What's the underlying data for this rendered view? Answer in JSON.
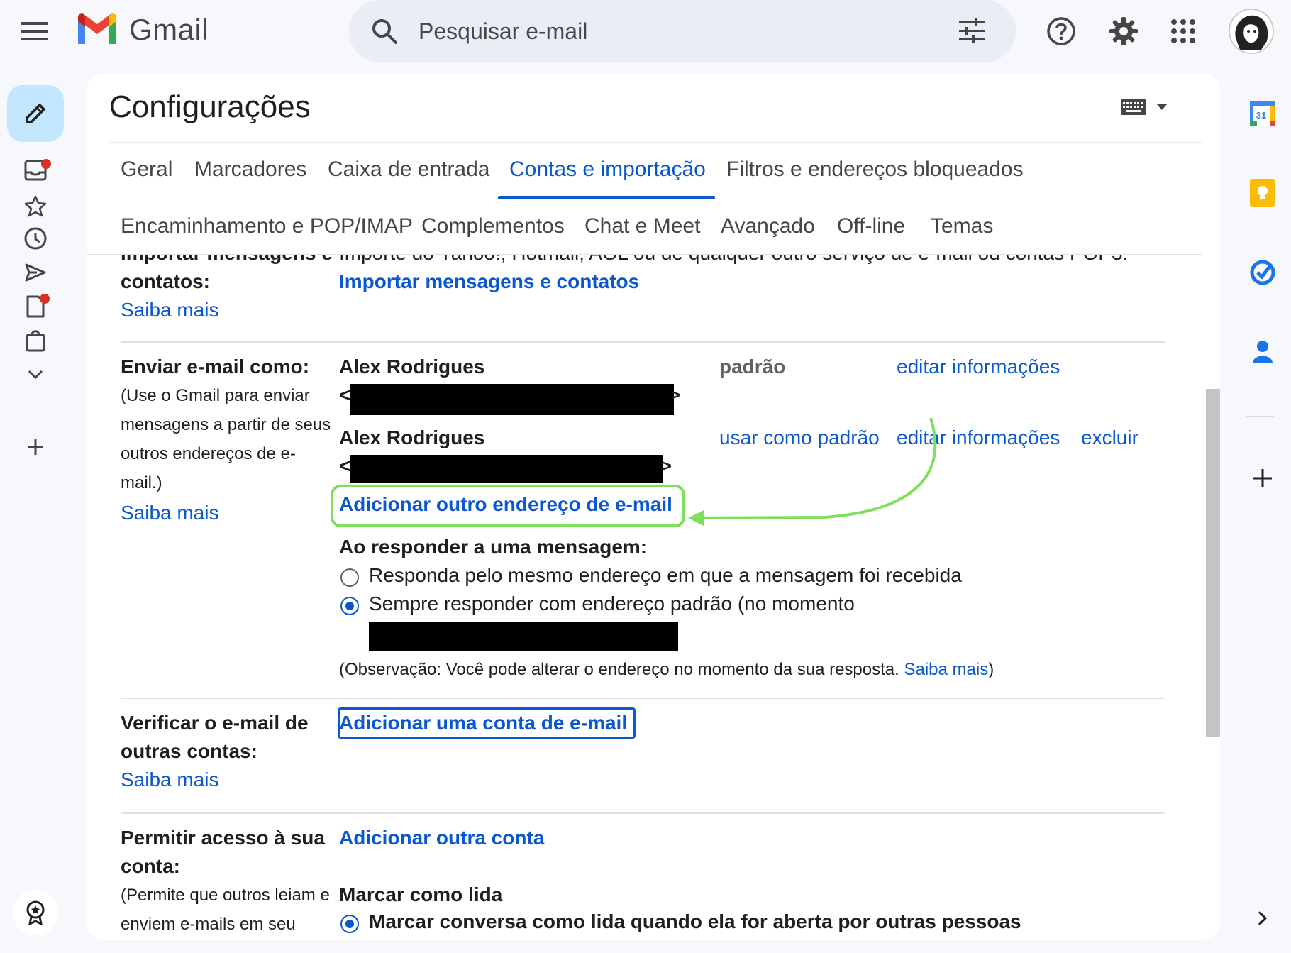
{
  "header": {
    "app_name": "Gmail",
    "search_placeholder": "Pesquisar e-mail"
  },
  "settings": {
    "title": "Configurações",
    "tabs_row1": [
      "Geral",
      "Marcadores",
      "Caixa de entrada",
      "Contas e importação",
      "Filtros e endereços bloqueados"
    ],
    "tabs_row2": [
      "Encaminhamento e POP/IMAP",
      "Complementos",
      "Chat e Meet",
      "Avançado",
      "Off-line",
      "Temas"
    ],
    "active_tab": "Contas e importação"
  },
  "import_section": {
    "label_partial": "Importar mensagens e",
    "label_rest": "contatos:",
    "desc_partial": "Importe do Yahoo!, Hotmail, AOL ou de qualquer outro serviço de e-mail ou contas POP3.",
    "action": "Importar mensagens e contatos",
    "learn_more": "Saiba mais"
  },
  "send_as": {
    "label": "Enviar e-mail como:",
    "desc_lines": [
      "(Use o Gmail para enviar",
      "mensagens a partir de seus",
      "outros endereços de e-",
      "mail.)"
    ],
    "learn_more": "Saiba mais",
    "accounts": [
      {
        "name": "Alex Rodrigues",
        "status": "padrão",
        "edit": "editar informações"
      },
      {
        "name": "Alex Rodrigues",
        "make_default": "usar como padrão",
        "edit": "editar informações",
        "delete": "excluir"
      }
    ],
    "add_address": "Adicionar outro endereço de e-mail",
    "reply_heading": "Ao responder a uma mensagem:",
    "reply_options": [
      {
        "label": "Responda pelo mesmo endereço em que a mensagem foi recebida",
        "selected": false
      },
      {
        "label": "Sempre responder com endereço padrão (no momento",
        "selected": true
      }
    ],
    "note_prefix": "(Observação: Você pode alterar o endereço no momento da sua resposta. ",
    "note_link": "Saiba mais",
    "note_suffix": ")"
  },
  "check_mail": {
    "label_lines": [
      "Verificar o e-mail de",
      "outras contas:"
    ],
    "learn_more": "Saiba mais",
    "action": "Adicionar uma conta de e-mail"
  },
  "grant_access": {
    "label_lines": [
      "Permitir acesso à sua",
      "conta:"
    ],
    "desc_lines": [
      "(Permite que outros leiam e",
      "enviem e-mails em seu"
    ],
    "action": "Adicionar outra conta",
    "mark_read_heading": "Marcar como lida",
    "mark_read_option": "Marcar conversa como lida quando ela for aberta por outras pessoas"
  },
  "right_rail": {
    "calendar_day": "31"
  },
  "colors": {
    "accent": "#0b57d0",
    "highlight": "#7de05a",
    "compose_bg": "#c2e7ff",
    "search_bg": "#e9eef6"
  }
}
